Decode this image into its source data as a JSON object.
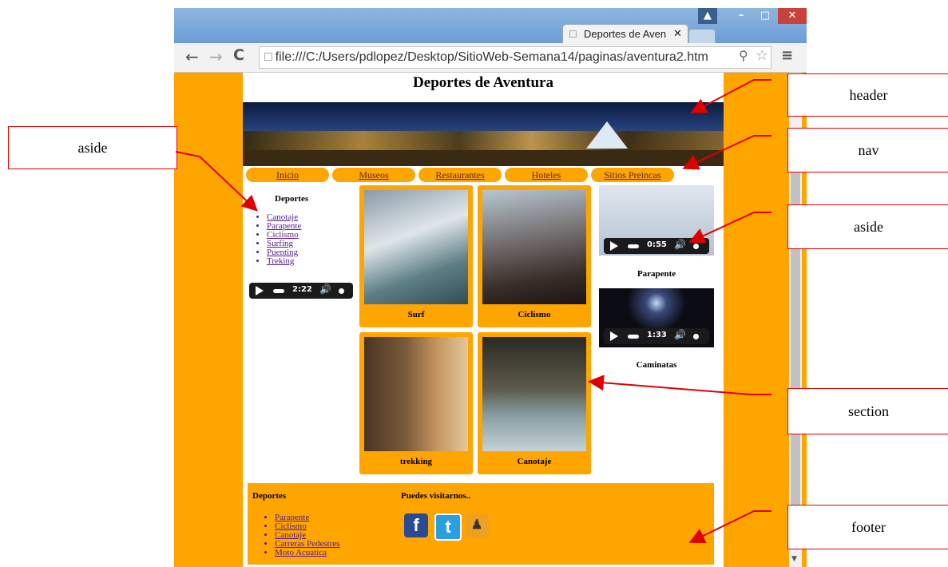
{
  "browser": {
    "tab_title": "Deportes de Aven",
    "address": "file:///C:/Users/pdlopez/Desktop/SitioWeb-Semana14/paginas/aventura2.htm",
    "icons": [
      "back-icon",
      "forward-icon",
      "reload-icon",
      "page-icon",
      "zoom-icon",
      "star-icon",
      "menu-icon",
      "user-icon",
      "minimize-icon",
      "maximize-icon",
      "close-icon"
    ]
  },
  "page": {
    "title": "Deportes de Aventura",
    "nav": [
      "Inicio",
      "Museos",
      "Restaurantes",
      "Hoteles",
      "Sitios Preincas"
    ],
    "aside_left": {
      "heading": "Deportes",
      "links": [
        "Canotaje",
        "Parapente",
        "Ciclismo",
        "Surfing",
        "Puenting",
        "Treking"
      ],
      "audio_time": "2:22"
    },
    "section": {
      "cards": [
        {
          "caption": "Surf"
        },
        {
          "caption": "Ciclismo"
        },
        {
          "caption": "trekking"
        },
        {
          "caption": "Canotaje"
        }
      ]
    },
    "aside_right": {
      "videos": [
        {
          "time": "0:55",
          "caption": "Parapente"
        },
        {
          "time": "1:33",
          "caption": "Caminatas"
        }
      ]
    },
    "footer": {
      "heading": "Deportes",
      "links": [
        "Parapente",
        "Ciclismo",
        "Canotaje",
        "Carreras Pedestres",
        "Moto Acuatica"
      ],
      "visit_heading": "Puedes visitarnos..",
      "social": [
        "facebook-icon",
        "twitter-icon",
        "people-icon"
      ]
    }
  },
  "annotations": {
    "aside_left": "aside",
    "header": "header",
    "nav": "nav",
    "aside_right": "aside",
    "section": "section",
    "footer": "footer"
  },
  "colors": {
    "page_bg": "#ffa500",
    "annotation": "#e00000",
    "chrome": "#6b9bd2"
  }
}
